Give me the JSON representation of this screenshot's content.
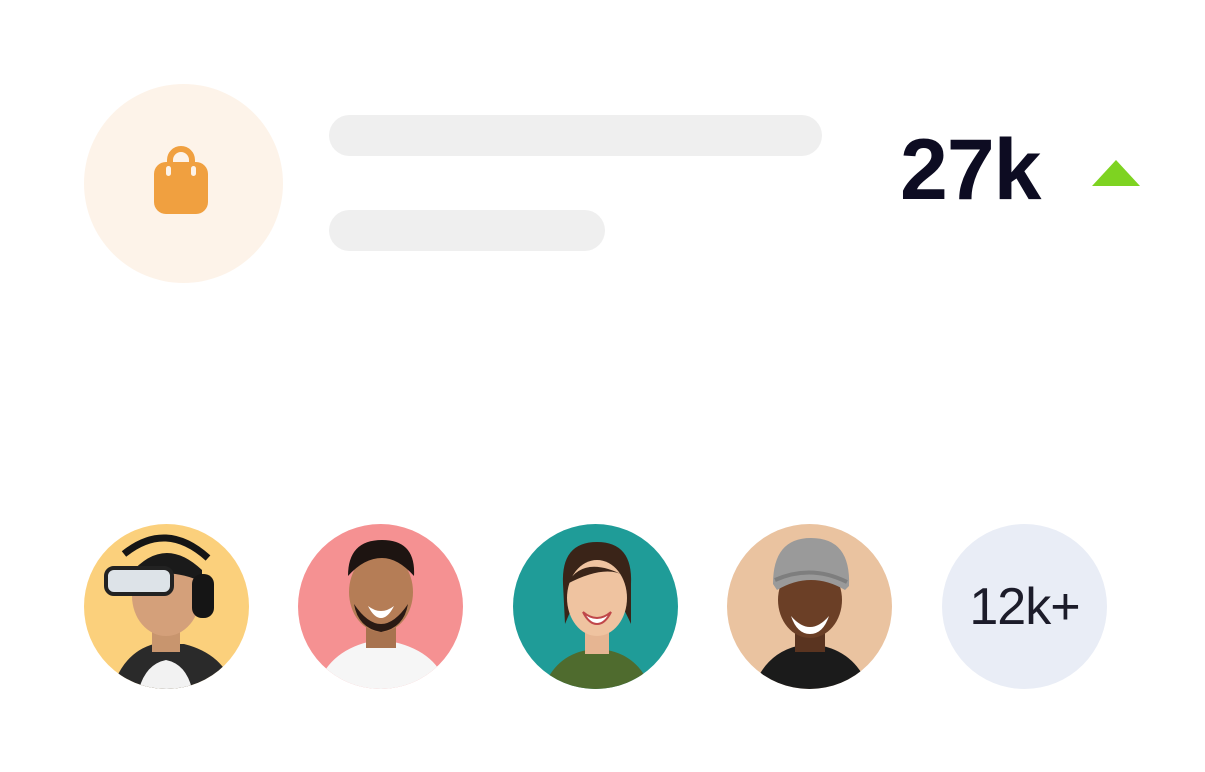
{
  "stat": {
    "value": "27k",
    "trend": "up",
    "trend_color": "#7ed321"
  },
  "category_icon": {
    "name": "shopping-bag-icon",
    "color": "#f0a040",
    "background": "#fdf3e9"
  },
  "audience": {
    "avatars": [
      {
        "name": "avatar-headphones-man",
        "background": "#fbd07c"
      },
      {
        "name": "avatar-smiling-man",
        "background": "#f59192"
      },
      {
        "name": "avatar-smiling-woman",
        "background": "#1f9c98"
      },
      {
        "name": "avatar-beanie-man",
        "background": "#eac3a0"
      }
    ],
    "more_label": "12k+"
  }
}
